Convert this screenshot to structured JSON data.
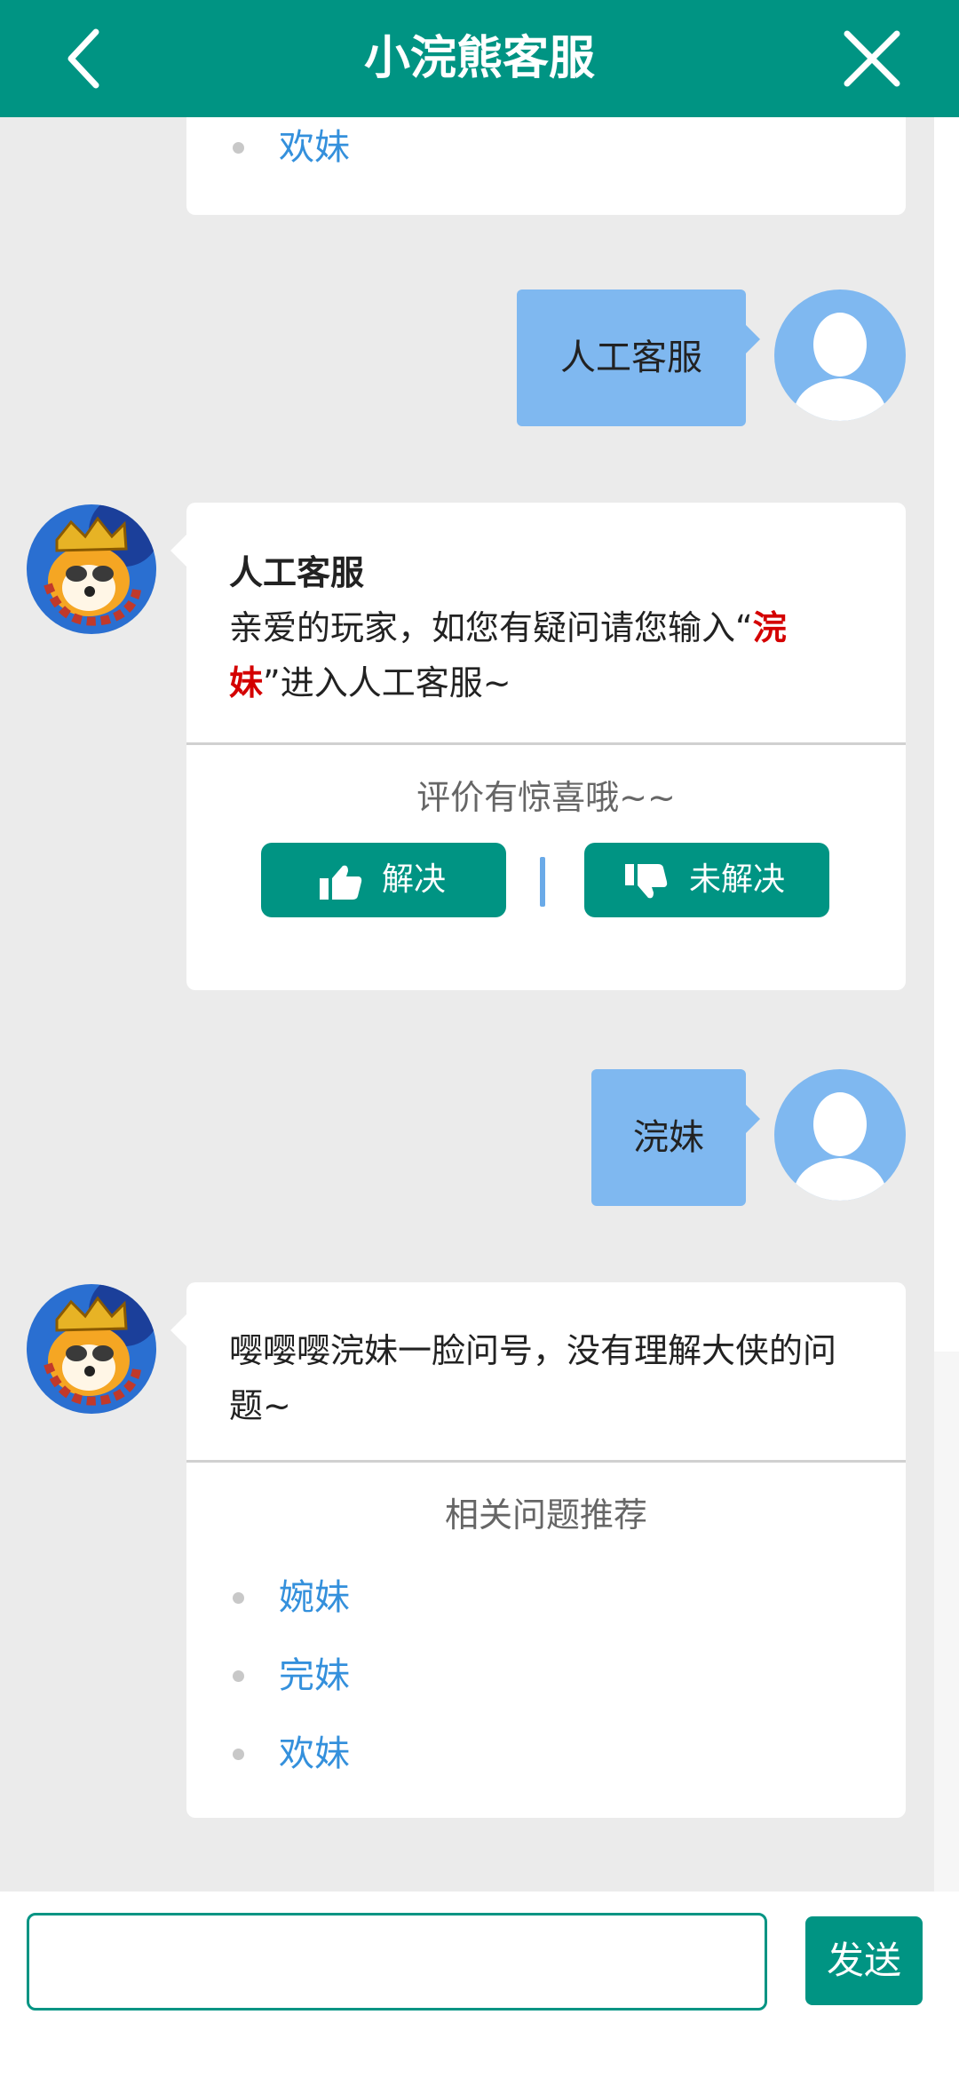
{
  "header": {
    "title": "小浣熊客服",
    "back_icon": "chevron-left-icon",
    "close_icon": "close-icon"
  },
  "messages": {
    "top_card": {
      "links": [
        "欢妹"
      ]
    },
    "user_1": {
      "text": "人工客服"
    },
    "bot_1": {
      "title": "人工客服",
      "text_before": "亲爱的玩家，如您有疑问请您输入“",
      "highlight": "浣妹",
      "text_after": "”进入人工客服~",
      "eval_title": "评价有惊喜哦~~",
      "solved_label": "解决",
      "unsolved_label": "未解决"
    },
    "user_2": {
      "text": "浣妹"
    },
    "bot_2": {
      "text": "嘤嘤嘤浣妹一脸问号，没有理解大侠的问题~",
      "related_title": "相关问题推荐",
      "links": [
        "婉妹",
        "完妹",
        "欢妹"
      ]
    }
  },
  "composer": {
    "input_value": "",
    "send_label": "发送"
  },
  "colors": {
    "brand": "#009483",
    "user_bubble": "#7fb8f0",
    "link": "#3490dc",
    "highlight": "#d40000"
  }
}
